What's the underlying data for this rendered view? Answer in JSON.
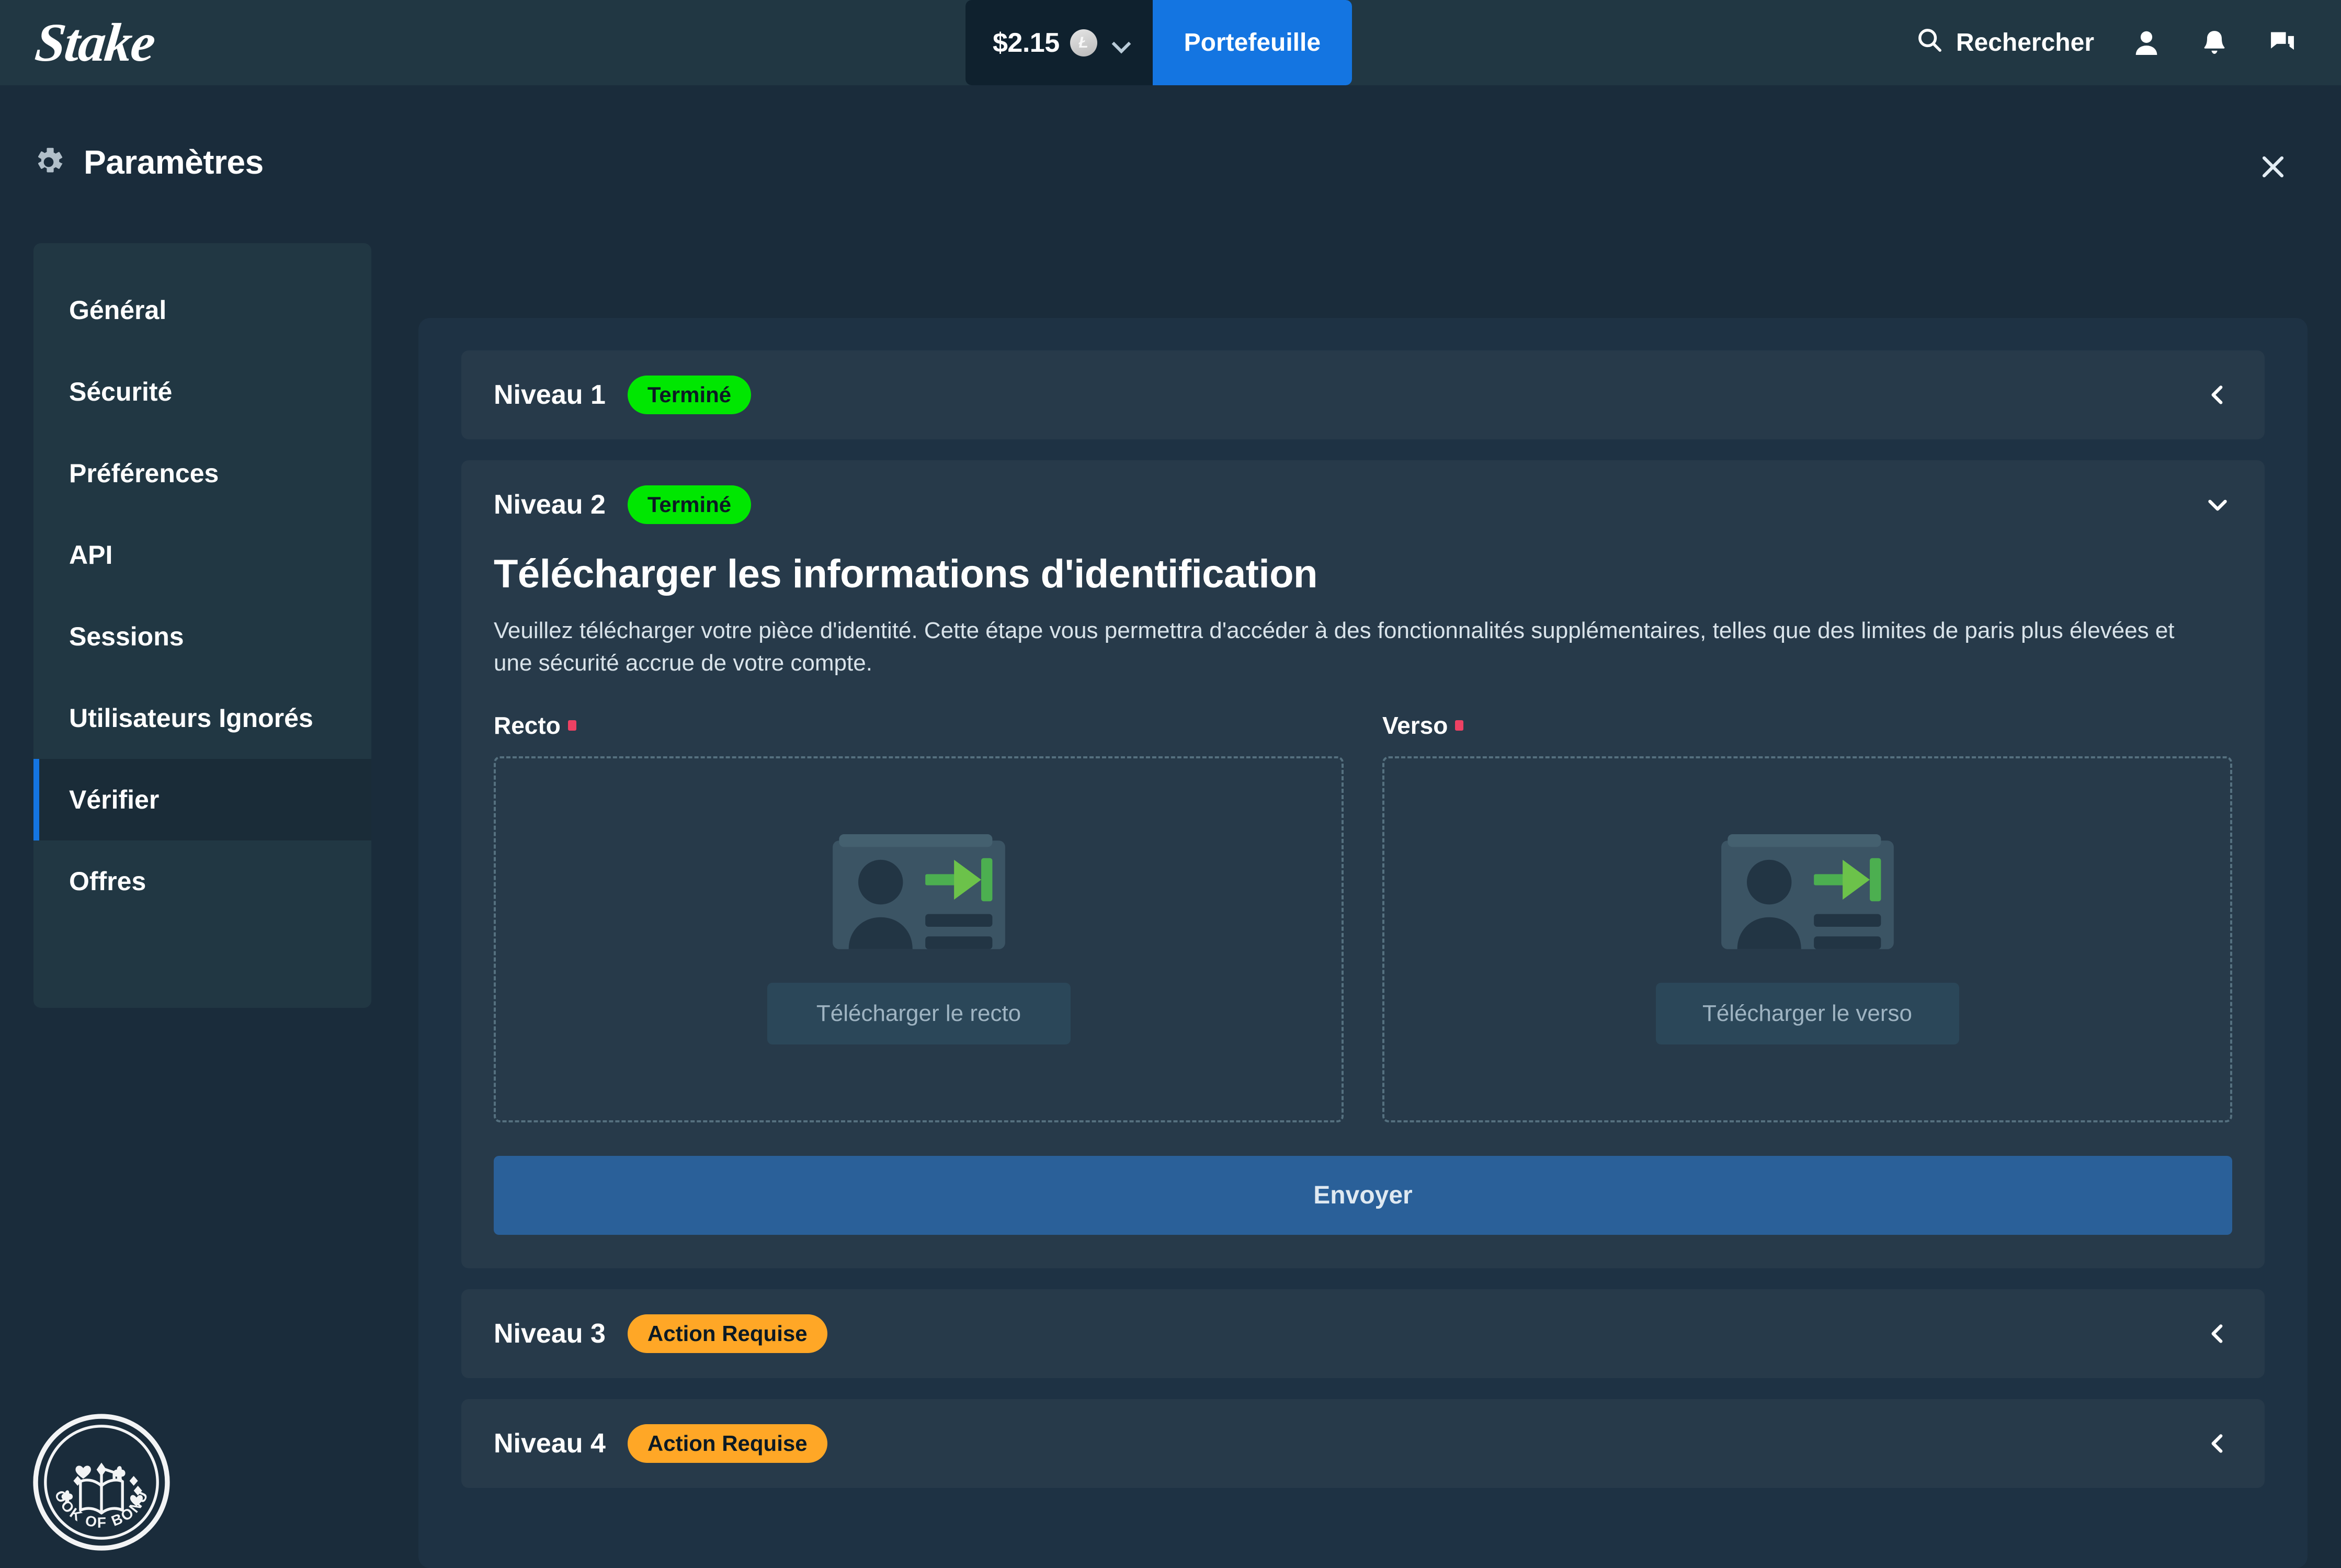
{
  "topbar": {
    "brand": "Stake",
    "balance": "$2.15",
    "coin_symbol": "Ł",
    "coin_icon": "litecoin-coin-icon",
    "currency_chevron_icon": "chevron-down-icon",
    "wallet_button": "Portefeuille",
    "search_icon": "search-icon",
    "search_label": "Rechercher",
    "profile_icon": "user-icon",
    "notifications_icon": "bell-icon",
    "chat_icon": "chat-bubble-icon",
    "accent_blue": "#1475e1",
    "bar_background": "#213743"
  },
  "modal": {
    "gear_icon": "gear-icon",
    "title": "Paramètres",
    "close_icon": "close-icon"
  },
  "sidebar": {
    "items": [
      {
        "label": "Général",
        "active": false
      },
      {
        "label": "Sécurité",
        "active": false
      },
      {
        "label": "Préférences",
        "active": false
      },
      {
        "label": "API",
        "active": false
      },
      {
        "label": "Sessions",
        "active": false
      },
      {
        "label": "Utilisateurs Ignorés",
        "active": false
      },
      {
        "label": "Vérifier",
        "active": true
      },
      {
        "label": "Offres",
        "active": false
      }
    ],
    "active_indicator_color": "#1475e1"
  },
  "verification": {
    "levels": [
      {
        "name": "Niveau 1",
        "status": "Terminé",
        "status_type": "done",
        "status_color": "#00e701",
        "chevron_icon": "chevron-left-icon",
        "expanded": false
      },
      {
        "name": "Niveau 2",
        "status": "Terminé",
        "status_type": "done",
        "status_color": "#00e701",
        "chevron_icon": "chevron-down-icon",
        "expanded": true
      },
      {
        "name": "Niveau 3",
        "status": "Action Requise",
        "status_type": "action",
        "status_color": "#ffa726",
        "chevron_icon": "chevron-left-icon",
        "expanded": false
      },
      {
        "name": "Niveau 4",
        "status": "Action Requise",
        "status_type": "action",
        "status_color": "#ffa726",
        "chevron_icon": "chevron-left-icon",
        "expanded": false
      }
    ],
    "panel": {
      "title": "Télécharger les informations d'identification",
      "description": "Veuillez télécharger votre pièce d'identité. Cette étape vous permettra d'accéder à des fonctionnalités supplémentaires, telles que des limites de paris plus élevées et une sécurité accrue de votre compte.",
      "front": {
        "label": "Recto",
        "required_mark": "*",
        "placeholder_icon": "id-card-import-icon",
        "button": "Télécharger le recto"
      },
      "back": {
        "label": "Verso",
        "required_mark": "*",
        "placeholder_icon": "id-card-import-icon",
        "button": "Télécharger le verso"
      },
      "submit_button": "Envoyer",
      "submit_color": "#2a6099"
    }
  },
  "watermark": {
    "icon": "book-of-bonus-badge-icon",
    "text": "BOOK OF BONUS"
  }
}
